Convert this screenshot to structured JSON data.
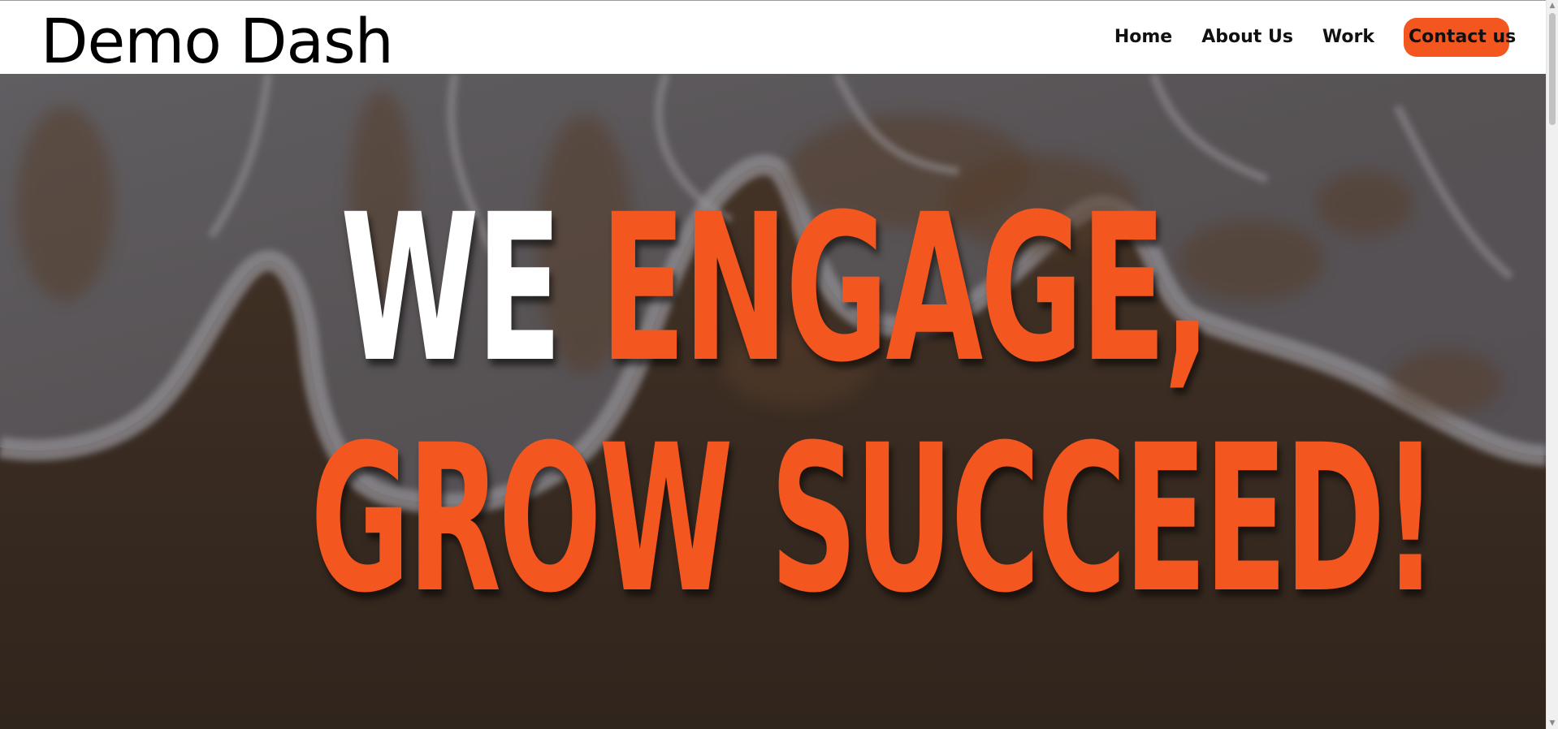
{
  "header": {
    "brand": "Demo Dash",
    "nav": [
      {
        "label": "Home"
      },
      {
        "label": "About Us"
      },
      {
        "label": "Work"
      }
    ],
    "contact_label": "Contact us"
  },
  "hero": {
    "line1_word1": "WE",
    "line1_word2": "ENGAGE,",
    "line2": "GROW SUCCEED!"
  },
  "colors": {
    "accent": "#f4561f",
    "white": "#ffffff",
    "text": "#111111"
  },
  "icons": {
    "scroll_up": "triangle-up-icon",
    "scroll_down": "triangle-down-icon"
  }
}
